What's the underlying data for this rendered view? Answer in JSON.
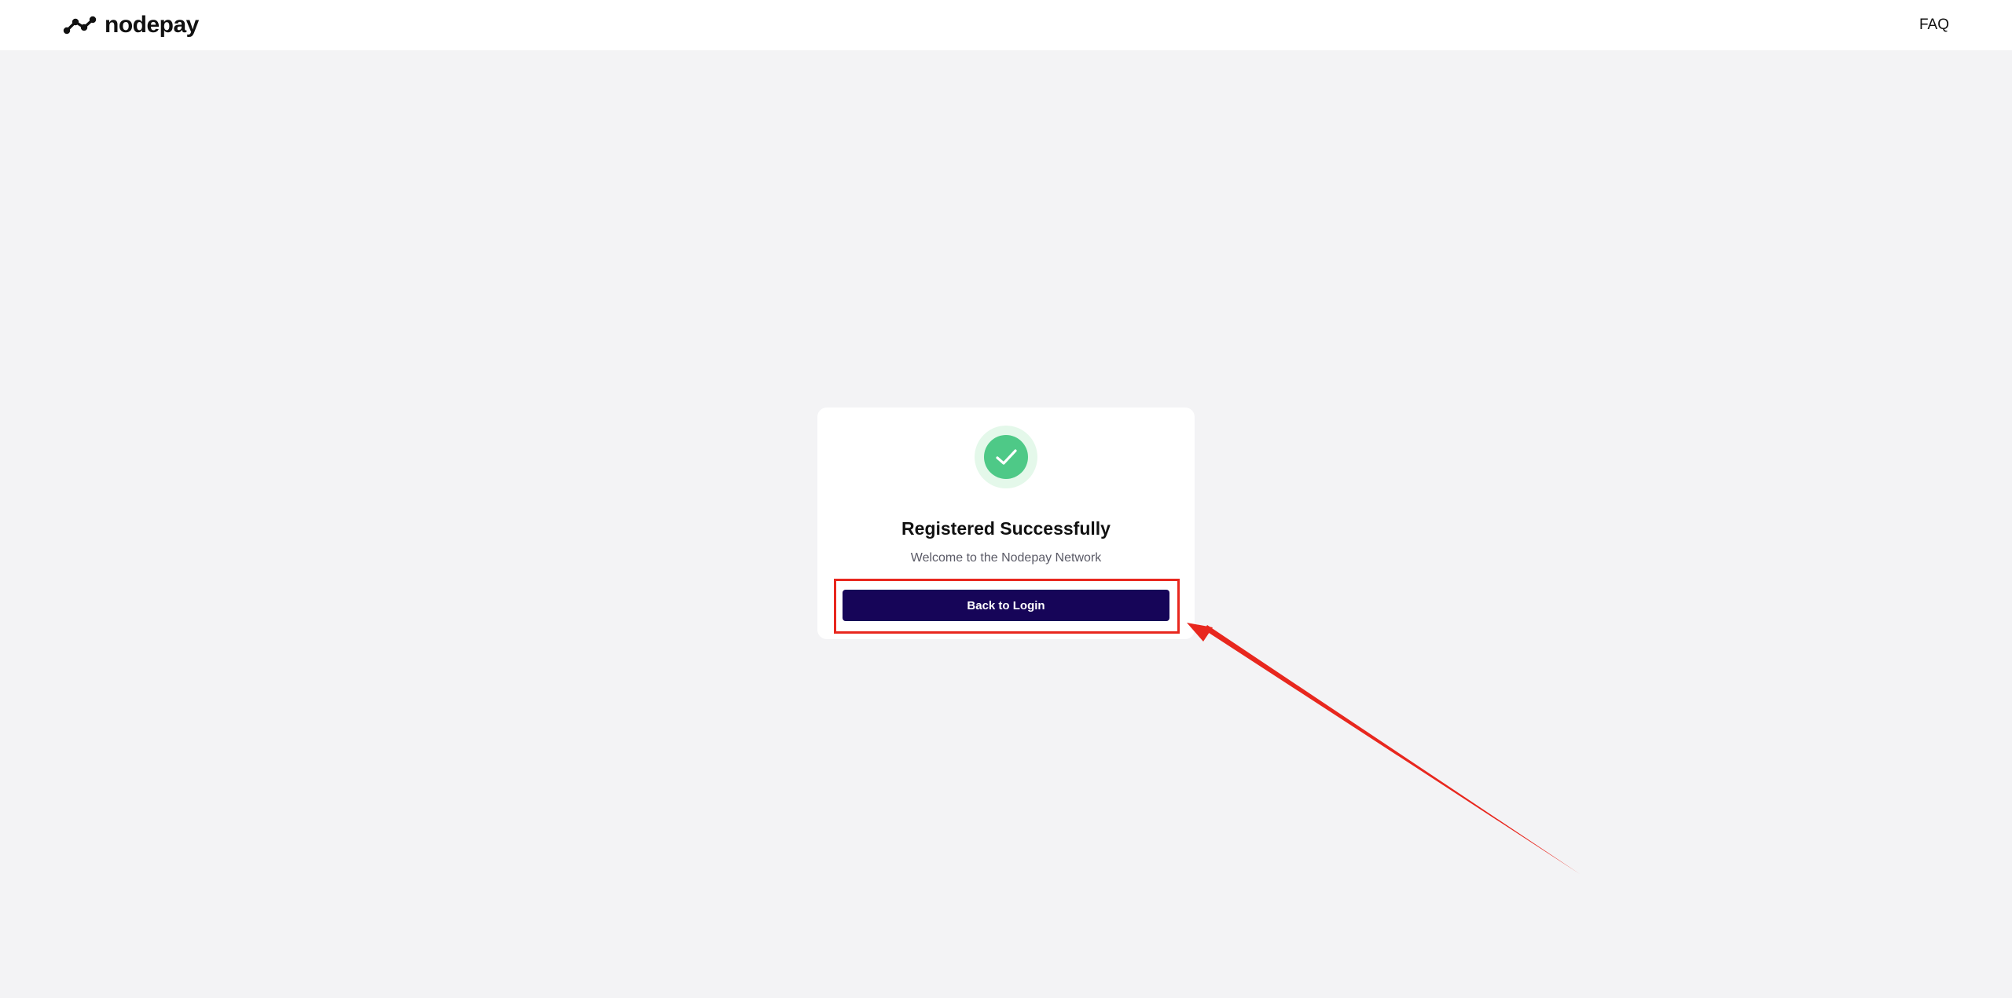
{
  "header": {
    "logo_text": "nodepay",
    "logo_icon": "node-graph-icon",
    "faq_label": "FAQ"
  },
  "card": {
    "status_icon": "checkmark-icon",
    "title": "Registered Successfully",
    "subtitle": "Welcome to the Nodepay Network",
    "button_label": "Back to Login"
  },
  "annotation": {
    "highlight_target": "primary-button",
    "arrow": "pointer-arrow"
  },
  "colors": {
    "page_background": "#f3f3f5",
    "header_background": "#ffffff",
    "card_background": "#ffffff",
    "primary_button": "#160558",
    "success_green": "#4ec987",
    "success_halo": "#e4f8ea",
    "annotation_red": "#e8271e",
    "text_primary": "#111111",
    "text_secondary": "#5a5a66"
  }
}
